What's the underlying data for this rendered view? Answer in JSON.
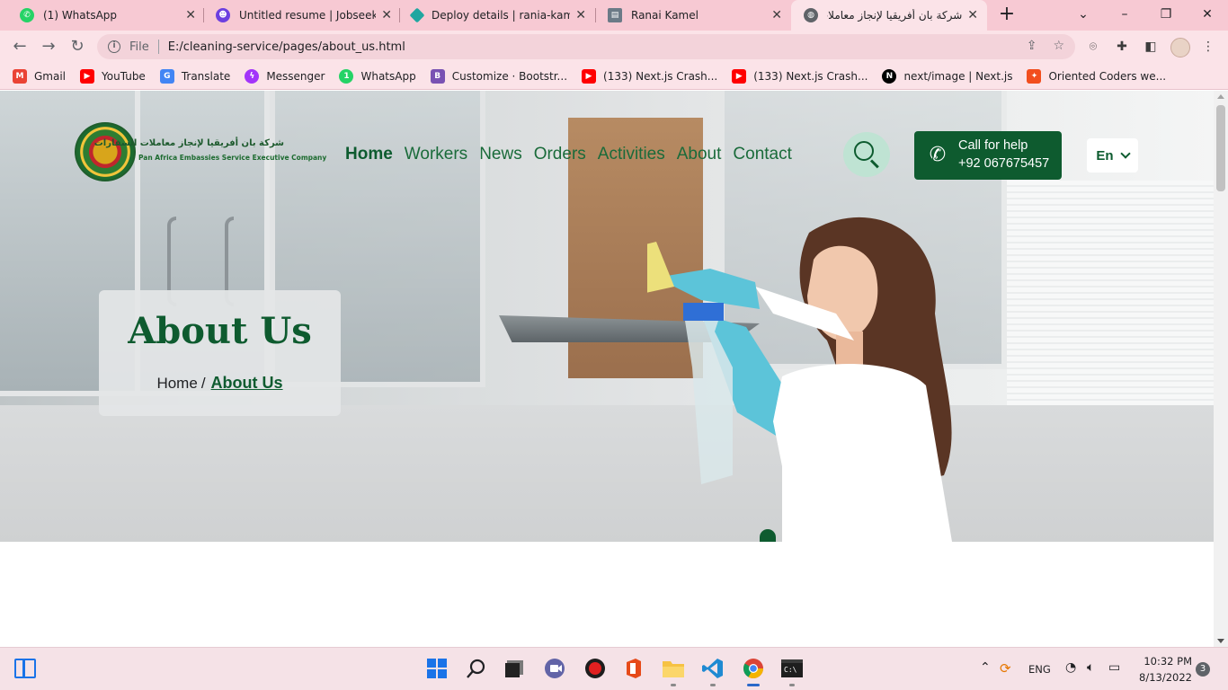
{
  "browser": {
    "tabs": [
      {
        "title": "(1) WhatsApp",
        "icon": "whatsapp-icon",
        "color": "#25d366"
      },
      {
        "title": "Untitled resume | Jobseeker",
        "icon": "jobseeker-icon",
        "color": "#6c3fe0"
      },
      {
        "title": "Deploy details | rania-kamel-",
        "icon": "netlify-icon",
        "color": "#20a6a0"
      },
      {
        "title": "Ranai Kamel",
        "icon": "page-icon",
        "color": "#6b7a87"
      },
      {
        "title": "شركة بان أفريقيا لإنجاز معاملات",
        "icon": "globe-icon",
        "color": "#5f6368"
      }
    ],
    "url_scheme": "File",
    "url": "E:/cleaning-service/pages/about_us.html",
    "bookmarks": [
      {
        "label": "Gmail",
        "icon": "gmail-icon",
        "color": "#ea4335"
      },
      {
        "label": "YouTube",
        "icon": "youtube-icon",
        "color": "#ff0000"
      },
      {
        "label": "Translate",
        "icon": "translate-icon",
        "color": "#4285f4"
      },
      {
        "label": "Messenger",
        "icon": "messenger-icon",
        "color": "#a334fa"
      },
      {
        "label": "WhatsApp",
        "icon": "whatsapp-icon",
        "color": "#25d366"
      },
      {
        "label": "Customize · Bootstr...",
        "icon": "bootstrap-icon",
        "color": "#7952b3"
      },
      {
        "label": "(133) Next.js Crash...",
        "icon": "youtube-icon",
        "color": "#ff0000"
      },
      {
        "label": "(133) Next.js Crash...",
        "icon": "youtube-icon",
        "color": "#ff0000"
      },
      {
        "label": "next/image | Next.js",
        "icon": "nextjs-icon",
        "color": "#000000"
      },
      {
        "label": "Oriented Coders we...",
        "icon": "figma-icon",
        "color": "#f24e1e"
      }
    ]
  },
  "site": {
    "logo_ar": "شركة بان أفريقيا لإنجاز معاملات السفارات",
    "logo_en": "Pan Africa Embassies Service Executive Company",
    "nav": [
      {
        "label": "Home",
        "active": true
      },
      {
        "label": "Workers",
        "active": false
      },
      {
        "label": "News",
        "active": false
      },
      {
        "label": "Orders",
        "active": false
      },
      {
        "label": "Activities",
        "active": false
      },
      {
        "label": "About",
        "active": false
      },
      {
        "label": "Contact",
        "active": false
      }
    ],
    "call_label": "Call for help",
    "call_number": "+92 067675457",
    "language": "En",
    "page_title": "About Us",
    "breadcrumb": {
      "home": "Home",
      "separator": "/",
      "current": "About Us"
    },
    "colors": {
      "primary": "#0e5b2f",
      "nav_text": "#1a6b3a",
      "search_bg": "#bfe3d3"
    }
  },
  "taskbar": {
    "apps": [
      "start-icon",
      "search-icon",
      "task-view-icon",
      "teams-icon",
      "record-icon",
      "office-icon",
      "file-explorer-icon",
      "vscode-icon",
      "chrome-icon",
      "terminal-icon"
    ],
    "language": "ENG",
    "time": "10:32 PM",
    "date": "8/13/2022",
    "notifications": "3"
  }
}
